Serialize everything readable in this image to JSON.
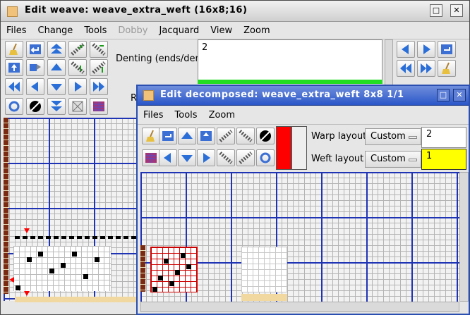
{
  "main_window": {
    "title": "Edit weave: weave_extra_weft (16x8;16)",
    "menu": [
      "Files",
      "Change",
      "Tools",
      "Dobby",
      "Jacquard",
      "View",
      "Zoom"
    ],
    "disabled_menu": "Dobby",
    "denting_label": "Denting (ends/dent)",
    "denting_value": "2",
    "r_label": "R",
    "buttons": {
      "minimize": "□",
      "close": "✕"
    }
  },
  "decomposed_window": {
    "title": "Edit decomposed: weave_extra_weft 8x8 1/1",
    "menu": [
      "Files",
      "Tools",
      "Zoom"
    ],
    "warp_layout_label": "Warp layout",
    "warp_layout_value": "Custom",
    "warp_layout_count": "2",
    "weft_layout_label": "Weft layout",
    "weft_layout_value": "Custom",
    "weft_layout_count": "1",
    "buttons": {
      "minimize": "□",
      "close": "✕"
    }
  },
  "colors": {
    "grid_line": "#1f33b5",
    "pattern_red": "#cc0000",
    "yellow_field": "#ffff00",
    "accent_red": "#ff0000",
    "titlebar_blue": "#2a56c8"
  }
}
